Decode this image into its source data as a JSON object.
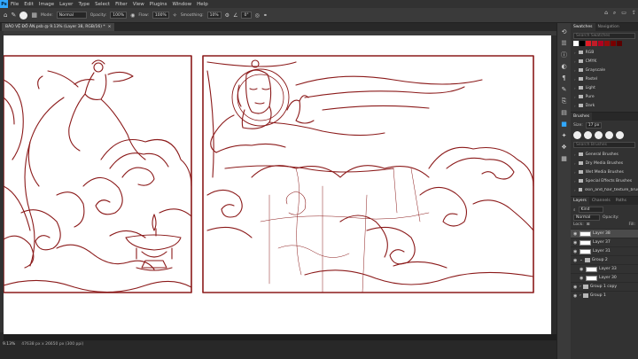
{
  "menubar": {
    "logo": "Ps",
    "items": [
      "File",
      "Edit",
      "Image",
      "Layer",
      "Type",
      "Select",
      "Filter",
      "View",
      "Plugins",
      "Window",
      "Help"
    ]
  },
  "options_bar": {
    "mode_label": "Mode:",
    "mode_value": "Normal",
    "opacity_label": "Opacity:",
    "opacity_value": "100%",
    "flow_label": "Flow:",
    "flow_value": "100%",
    "smoothing_label": "Smoothing:",
    "smoothing_value": "10%",
    "angle_value": "0°"
  },
  "document": {
    "tab_title": "BẢO VỆ ĐỒ ÁN.psb @ 9.13% (Layer 38, RGB/16) *",
    "zoom": "9.13%",
    "info": "47638 px x 26650 px (300 ppi)"
  },
  "swatches_panel": {
    "tabs": [
      "Swatches",
      "Navigation"
    ],
    "search_placeholder": "Search Swatches",
    "colors": [
      "#ffffff",
      "#000000",
      "#e01b24",
      "#c01c28",
      "#b00020",
      "#9a0b0b",
      "#7a0000",
      "#5a0000"
    ],
    "folders": [
      "RGB",
      "CMYK",
      "Grayscale",
      "Pastel",
      "Light",
      "Pure",
      "Dark"
    ]
  },
  "brushes_panel": {
    "title": "Brushes",
    "size_label": "Size:",
    "size_value": "17 px",
    "search_placeholder": "Search Brushes",
    "folders": [
      "General Brushes",
      "Dry Media Brushes",
      "Wet Media Brushes",
      "Special Effects Brushes",
      "skin_and_hair_texture_brushes_b"
    ]
  },
  "layers_panel": {
    "tabs": [
      "Layers",
      "Channels",
      "Paths"
    ],
    "kind_label": "Kind",
    "blend_mode": "Normal",
    "opacity_label": "Opacity:",
    "lock_label": "Lock:",
    "fill_label": "Fill:",
    "layers": [
      {
        "name": "Layer 38",
        "active": true
      },
      {
        "name": "Layer 37",
        "active": false
      },
      {
        "name": "Layer 31",
        "active": false
      },
      {
        "name": "Group 2",
        "active": false
      },
      {
        "name": "Layer 33",
        "active": false
      },
      {
        "name": "Layer 30",
        "active": false
      },
      {
        "name": "Group 1 copy",
        "active": false
      },
      {
        "name": "Group 1",
        "active": false
      }
    ]
  },
  "colors": {
    "line_art": "#8b1a1a",
    "accent": "#31a8ff"
  }
}
